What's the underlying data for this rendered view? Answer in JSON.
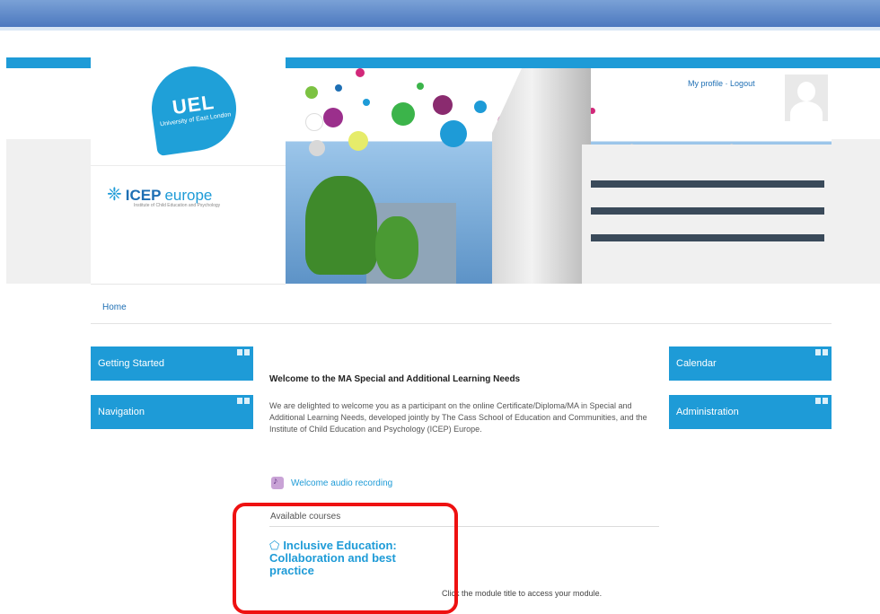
{
  "header": {
    "logo_uel_main": "UEL",
    "logo_uel_sub": "University of East London",
    "logo_icep_bold": "ICEP",
    "logo_icep_rest": "europe",
    "logo_icep_tagline": "Institute of Child Education and Psychology",
    "my_profile": "My profile",
    "separator": "·",
    "logout": "Logout"
  },
  "breadcrumb": {
    "home": "Home"
  },
  "left_blocks": [
    {
      "label": "Getting Started"
    },
    {
      "label": "Navigation"
    }
  ],
  "right_blocks": [
    {
      "label": "Calendar"
    },
    {
      "label": "Administration"
    }
  ],
  "main": {
    "welcome_title": "Welcome to the MA Special and Additional Learning Needs",
    "welcome_text": "We are delighted to welcome you as a participant on the online Certificate/Diploma/MA in Special and Additional Learning Needs, developed jointly by The Cass School of Education and Communities, and the Institute of Child Education and Psychology (ICEP) Europe.",
    "audio_link": "Welcome audio recording",
    "available_courses": "Available courses",
    "course_title": "Inclusive Education: Collaboration and best practice",
    "instruction": "Click the module title to access your module."
  },
  "colors": {
    "accent": "#1e9bd7",
    "highlight_box": "#ee1111"
  }
}
